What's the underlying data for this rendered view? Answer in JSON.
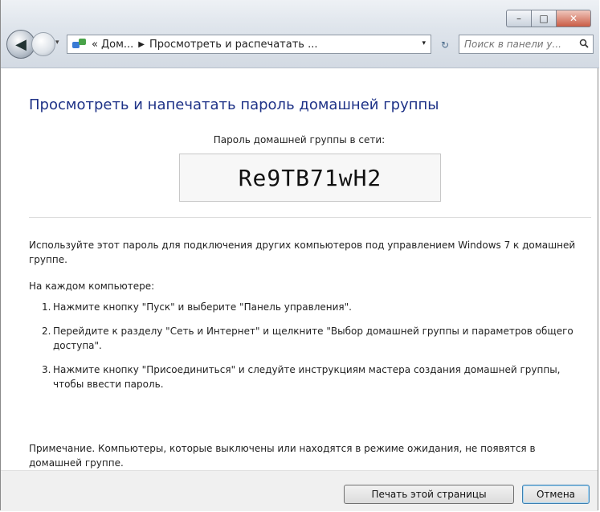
{
  "window": {
    "caption_buttons": {
      "minimize": "–",
      "maximize": "□",
      "close": "✕"
    }
  },
  "navigation": {
    "back_glyph": "◀",
    "dropdown_glyph": "▾"
  },
  "address_bar": {
    "prefix": "«",
    "crumbs": [
      "Дом...",
      "Просмотреть и распечатать ..."
    ],
    "separator": "▶",
    "dropdown_glyph": "▾"
  },
  "refresh_glyph": "↻",
  "search": {
    "placeholder": "Поиск в панели у..."
  },
  "main": {
    "heading": "Просмотреть и напечатать пароль домашней группы",
    "password_label": "Пароль домашней группы в сети:",
    "password": "Re9TB71wH2",
    "paragraph1": "Используйте этот пароль для подключения других компьютеров под управлением Windows 7 к домашней группе.",
    "paragraph2": "На каждом компьютере:",
    "steps": [
      {
        "num": "1.",
        "text": "Нажмите кнопку \"Пуск\" и выберите \"Панель управления\"."
      },
      {
        "num": "2.",
        "text": "Перейдите к разделу \"Сеть и Интернет\" и щелкните \"Выбор домашней группы и параметров общего доступа\"."
      },
      {
        "num": "3.",
        "text": "Нажмите кнопку \"Присоединиться\" и следуйте инструкциям мастера создания  домашней группы, чтобы ввести пароль."
      }
    ],
    "note": "Примечание. Компьютеры, которые выключены или находятся в режиме ожидания, не появятся в домашней группе."
  },
  "footer": {
    "print_label": "Печать этой страницы",
    "cancel_label": "Отмена"
  }
}
